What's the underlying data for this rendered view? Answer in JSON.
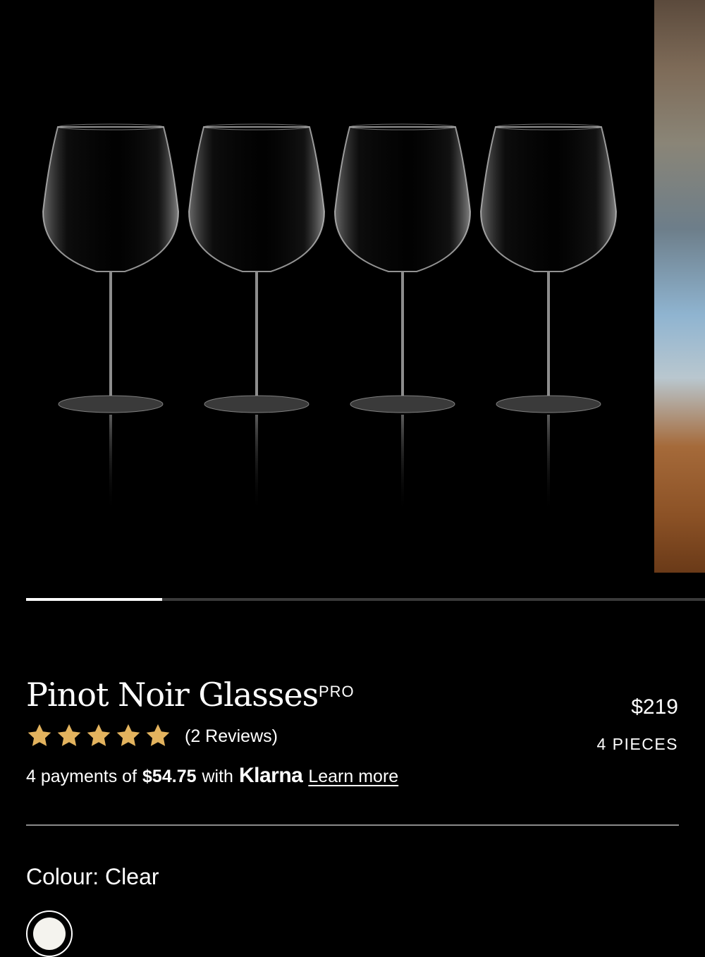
{
  "product": {
    "title": "Pinot Noir Glasses",
    "badge": "PRO",
    "price": "$219",
    "pieces": "4 PIECES",
    "rating": 5,
    "rating_max": 5,
    "reviews": "(2 Reviews)"
  },
  "gallery": {
    "progress_fraction": 0.2,
    "glass_count": 4
  },
  "payment": {
    "prefix": "4 payments of",
    "amount": "$54.75",
    "with": "with",
    "provider": "Klarna",
    "link": "Learn more"
  },
  "colour": {
    "label": "Colour: Clear",
    "selected_swatch": "#f4f3ee"
  },
  "colors": {
    "background": "#000000",
    "star": "#e3b35e",
    "text": "#ffffff"
  },
  "icons": {
    "star": "star-icon"
  }
}
